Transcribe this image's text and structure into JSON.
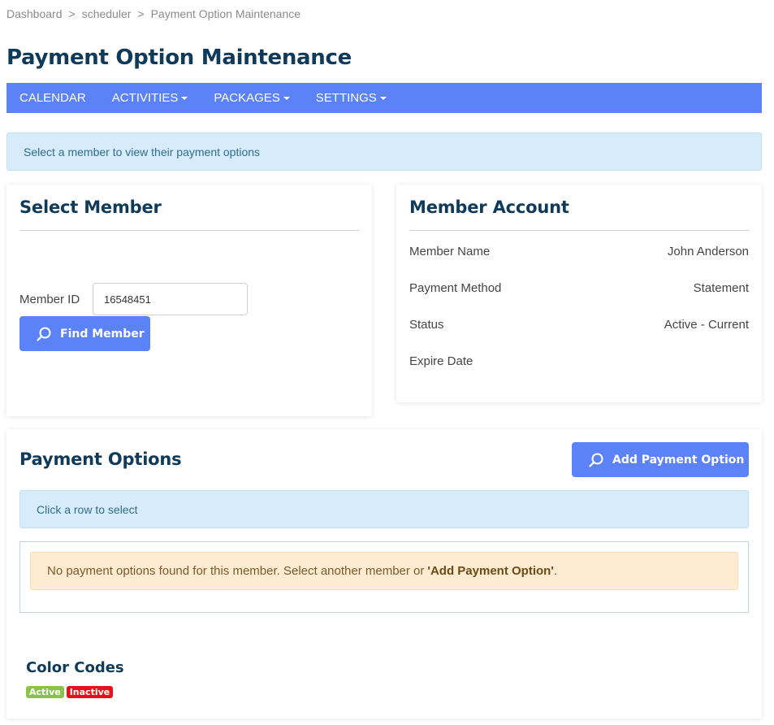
{
  "breadcrumb": {
    "items": [
      "Dashboard",
      "scheduler",
      "Payment Option Maintenance"
    ],
    "separator": ">"
  },
  "page": {
    "title": "Payment Option Maintenance"
  },
  "nav": {
    "color": "#5b82f7",
    "items": [
      {
        "label": "CALENDAR",
        "dropdown": false
      },
      {
        "label": "ACTIVITIES",
        "dropdown": true
      },
      {
        "label": "PACKAGES",
        "dropdown": true
      },
      {
        "label": "SETTINGS",
        "dropdown": true
      }
    ]
  },
  "top_alert": {
    "text": "Select a member to view their payment options"
  },
  "select_member": {
    "title": "Select Member",
    "member_id_label": "Member ID",
    "member_id_value": "16548451",
    "find_button": {
      "label": "Find Member",
      "icon": "search-icon"
    }
  },
  "member_account": {
    "title": "Member Account",
    "rows": [
      {
        "label": "Member Name",
        "value": "John Anderson"
      },
      {
        "label": "Payment Method",
        "value": "Statement"
      },
      {
        "label": "Status",
        "value": "Active - Current"
      },
      {
        "label": "Expire Date",
        "value": ""
      }
    ]
  },
  "payment_options": {
    "title": "Payment Options",
    "add_button": {
      "label": "Add Payment Option",
      "icon": "search-icon"
    },
    "hint": "Click a row to select",
    "empty_message_prefix": "No payment options found for this member. Select another member or",
    "empty_message_emphasis": "'Add Payment Option'",
    "empty_message_suffix": "."
  },
  "color_codes": {
    "title": "Color Codes",
    "badges": [
      {
        "label": "Active",
        "color": "#8bc34a"
      },
      {
        "label": "Inactive",
        "color": "#e8101a"
      }
    ]
  }
}
